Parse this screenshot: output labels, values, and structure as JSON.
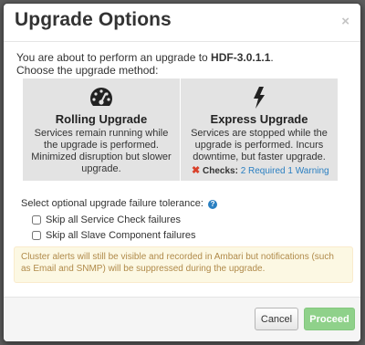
{
  "dialog": {
    "title": "Upgrade Options",
    "close_glyph": "×"
  },
  "intro": {
    "line1_prefix": "You are about to perform an upgrade to ",
    "version": "HDF-3.0.1.1",
    "line1_suffix": ".",
    "line2": "Choose the upgrade method:"
  },
  "methods": [
    {
      "icon": "dashboard-gauge-icon",
      "title": "Rolling Upgrade",
      "description": "Services remain running while the upgrade is performed. Minimized disruption but slower upgrade."
    },
    {
      "icon": "lightning-bolt-icon",
      "title": "Express Upgrade",
      "description": "Services are stopped while the upgrade is performed. Incurs downtime, but faster upgrade.",
      "checks": {
        "status_glyph": "✖",
        "label": "Checks:",
        "required": "2 Required",
        "warning": "1 Warning"
      }
    }
  ],
  "tolerance": {
    "label": "Select optional upgrade failure tolerance:",
    "help_glyph": "?",
    "options": [
      {
        "label": "Skip all Service Check failures",
        "checked": false
      },
      {
        "label": "Skip all Slave Component failures",
        "checked": false
      }
    ]
  },
  "alert": {
    "text": "Cluster alerts will still be visible and recorded in Ambari but notifications (such as Email and SNMP) will be suppressed during the upgrade."
  },
  "footer": {
    "cancel_label": "Cancel",
    "proceed_label": "Proceed"
  },
  "colors": {
    "panel_bg": "#e3e3e3",
    "link": "#2a7fc1",
    "error": "#d9412b",
    "alert_bg": "#fcf8e3",
    "alert_text": "#b08a4a",
    "proceed_bg": "#8fd18a"
  }
}
